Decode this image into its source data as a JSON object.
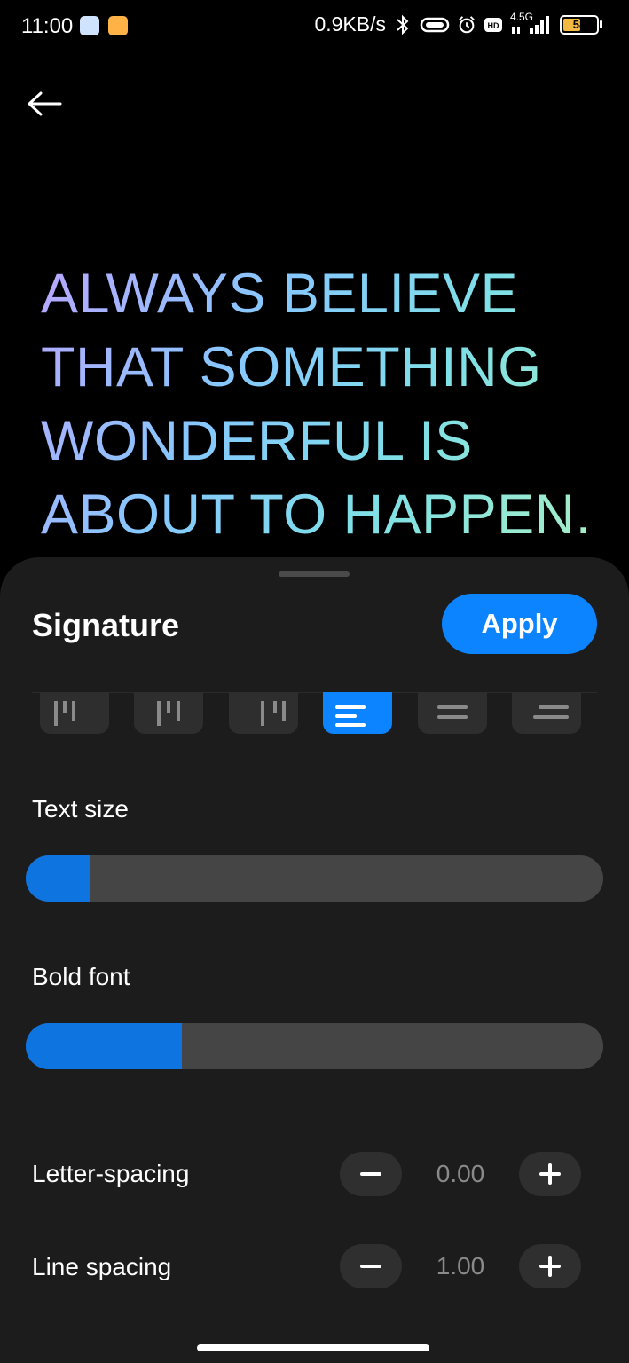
{
  "status_bar": {
    "time": "11:00",
    "network_speed": "0.9KB/s",
    "network_type": "4.5G",
    "battery": "58",
    "battery_level_percent": 58,
    "icons": [
      "bluetooth-icon",
      "vr-headset-icon",
      "alarm-icon",
      "hd-icon",
      "signal-icon",
      "battery-icon"
    ]
  },
  "header": {
    "back_icon": "arrow-left-icon"
  },
  "preview": {
    "lines": [
      "ALWAYS BELIEVE",
      "THAT SOMETHING",
      "WONDERFUL IS",
      "ABOUT TO HAPPEN."
    ],
    "gradient_colors": [
      "#b9a6ff",
      "#86c8ff",
      "#7fe0e6",
      "#a9f0c4"
    ]
  },
  "sheet": {
    "title": "Signature",
    "apply_label": "Apply",
    "alignment_options": [
      {
        "name": "vertical-left",
        "selected": false
      },
      {
        "name": "vertical-center",
        "selected": false
      },
      {
        "name": "vertical-right",
        "selected": false
      },
      {
        "name": "horizontal-left",
        "selected": true
      },
      {
        "name": "horizontal-center",
        "selected": false
      },
      {
        "name": "horizontal-right",
        "selected": false
      }
    ],
    "text_size": {
      "label": "Text size",
      "value_percent": 11
    },
    "bold_font": {
      "label": "Bold font",
      "value_percent": 27
    },
    "letter_spacing": {
      "label": "Letter-spacing",
      "value": "0.00"
    },
    "line_spacing": {
      "label": "Line spacing",
      "value": "1.00"
    }
  },
  "colors": {
    "accent": "#0d84ff",
    "sheet_background": "#1c1c1c",
    "track": "#454545"
  }
}
